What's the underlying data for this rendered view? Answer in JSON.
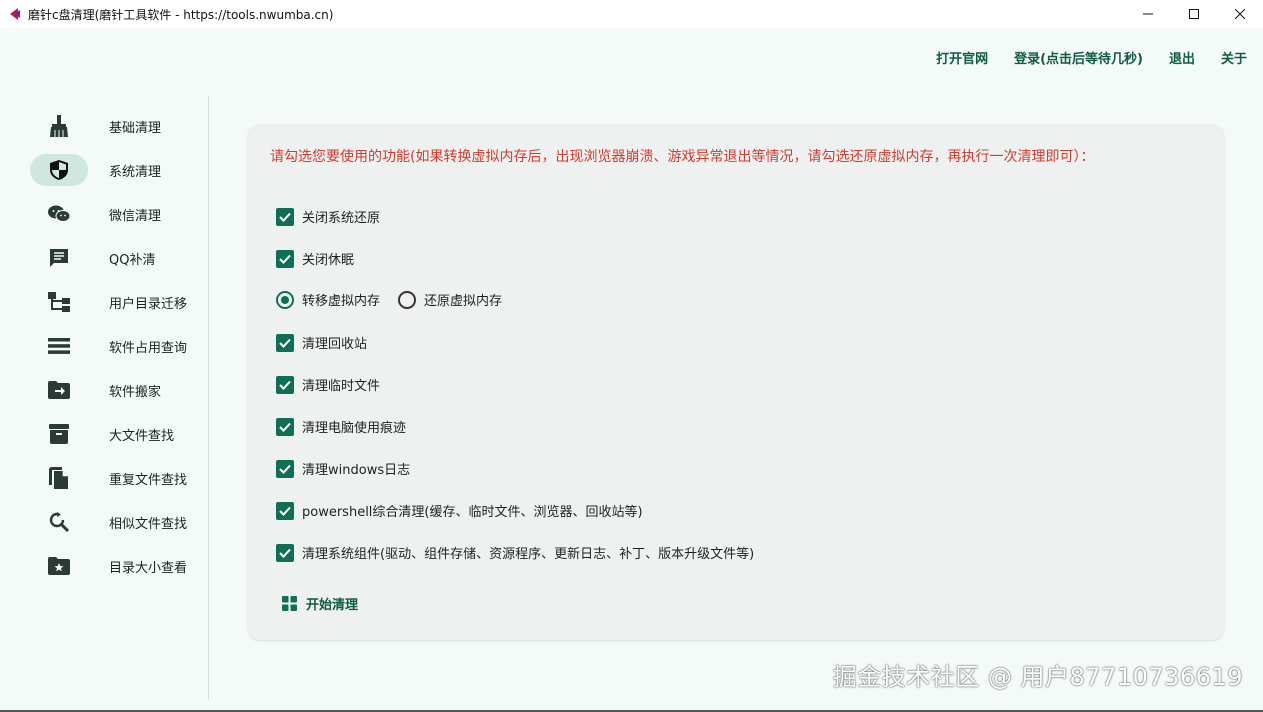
{
  "window": {
    "title": "磨针c盘清理(磨针工具软件 - https://tools.nwumba.cn)",
    "minimize": "—",
    "maximize": "☐",
    "close": "✕"
  },
  "topnav": {
    "official_site": "打开官网",
    "login": "登录(点击后等待几秒)",
    "logout": "退出",
    "about": "关于"
  },
  "sidebar": {
    "items": [
      {
        "label": "基础清理",
        "icon": "broom-icon"
      },
      {
        "label": "系统清理",
        "icon": "shield-icon",
        "active": true
      },
      {
        "label": "微信清理",
        "icon": "wechat-icon"
      },
      {
        "label": "QQ补清",
        "icon": "chat-bubble-icon"
      },
      {
        "label": "用户目录迁移",
        "icon": "tree-icon"
      },
      {
        "label": "软件占用查询",
        "icon": "list-icon"
      },
      {
        "label": "软件搬家",
        "icon": "folder-move-icon"
      },
      {
        "label": "大文件查找",
        "icon": "archive-icon"
      },
      {
        "label": "重复文件查找",
        "icon": "copy-icon"
      },
      {
        "label": "相似文件查找",
        "icon": "search-refresh-icon"
      },
      {
        "label": "目录大小查看",
        "icon": "folder-star-icon"
      }
    ]
  },
  "main": {
    "notice": "请勾选您要使用的功能(如果转换虚拟内存后，出现浏览器崩溃、游戏异常退出等情况，请勾选还原虚拟内存，再执行一次清理即可）：",
    "options": [
      {
        "label": "关闭系统还原",
        "checked": true
      },
      {
        "label": "关闭休眠",
        "checked": true
      }
    ],
    "radio": [
      {
        "label": "转移虚拟内存",
        "selected": true
      },
      {
        "label": "还原虚拟内存",
        "selected": false
      }
    ],
    "options2": [
      {
        "label": "清理回收站",
        "checked": true
      },
      {
        "label": "清理临时文件",
        "checked": true
      },
      {
        "label": "清理电脑使用痕迹",
        "checked": true
      },
      {
        "label": "清理windows日志",
        "checked": true
      },
      {
        "label": "powershell综合清理(缓存、临时文件、浏览器、回收站等)",
        "checked": true
      },
      {
        "label": "清理系统组件(驱动、组件存储、资源程序、更新日志、补丁、版本升级文件等)",
        "checked": true
      }
    ],
    "start_button": "开始清理"
  },
  "watermark": "掘金技术社区 @ 用户87710736619",
  "colors": {
    "accent": "#0f6f56",
    "notice": "#d6392d",
    "background": "#f3faf7",
    "card": "#eef1f0"
  }
}
